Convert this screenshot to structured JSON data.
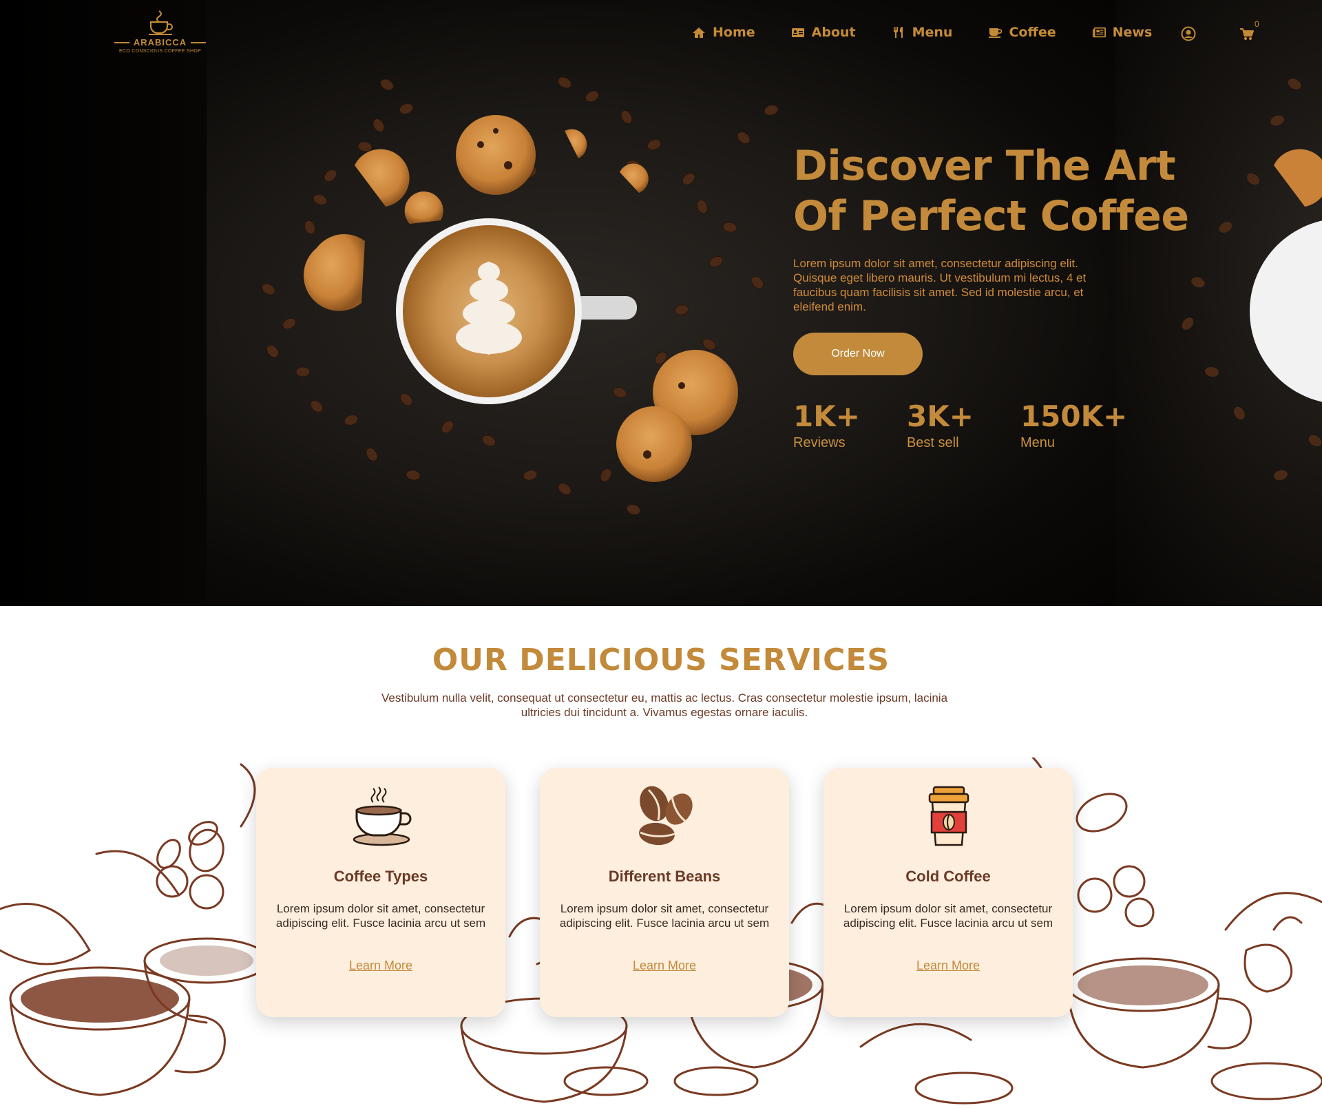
{
  "brand": {
    "name": "ARABICCA",
    "tagline": "ECO CONSCIOUS COFFEE SHOP"
  },
  "nav": {
    "items": [
      {
        "label": "Home",
        "icon": "home-icon"
      },
      {
        "label": "About",
        "icon": "id-card-icon"
      },
      {
        "label": "Menu",
        "icon": "utensils-icon"
      },
      {
        "label": "Coffee",
        "icon": "coffee-cup-icon"
      },
      {
        "label": "News",
        "icon": "newspaper-icon"
      }
    ],
    "user_icon": "user-circle-icon",
    "cart_icon": "cart-icon",
    "cart_count": "0"
  },
  "hero": {
    "title_line1": "Discover The Art",
    "title_line2": "Of Perfect Coffee",
    "description": "Lorem ipsum dolor sit amet, consectetur adipiscing elit. Quisque eget libero mauris. Ut vestibulum mi lectus, 4 et faucibus quam facilisis sit amet. Sed id molestie arcu, et eleifend enim.",
    "cta_label": "Order Now",
    "stats": [
      {
        "value": "1K+",
        "label": "Reviews"
      },
      {
        "value": "3K+",
        "label": "Best sell"
      },
      {
        "value": "150K+",
        "label": "Menu"
      }
    ]
  },
  "services": {
    "title": "OUR DELICIOUS SERVICES",
    "description": "Vestibulum nulla velit, consequat ut consectetur eu, mattis ac lectus. Cras consectetur molestie ipsum, lacinia ultricies dui tincidunt a. Vivamus egestas ornare iaculis.",
    "cards": [
      {
        "title": "Coffee Types",
        "text": "Lorem ipsum dolor sit amet, consectetur adipiscing elit. Fusce lacinia arcu ut sem",
        "link": "Learn More",
        "icon": "hot-coffee-cup-icon"
      },
      {
        "title": "Different Beans",
        "text": "Lorem ipsum dolor sit amet, consectetur adipiscing elit. Fusce lacinia arcu ut sem",
        "link": "Learn More",
        "icon": "coffee-beans-icon"
      },
      {
        "title": "Cold Coffee",
        "text": "Lorem ipsum dolor sit amet, consectetur adipiscing elit. Fusce lacinia arcu ut sem",
        "link": "Learn More",
        "icon": "takeaway-cup-icon"
      }
    ]
  },
  "colors": {
    "accent": "#c28a3a",
    "dark_brown": "#6b3a26",
    "card_bg": "#fdeede",
    "hero_bg": "#050403"
  }
}
